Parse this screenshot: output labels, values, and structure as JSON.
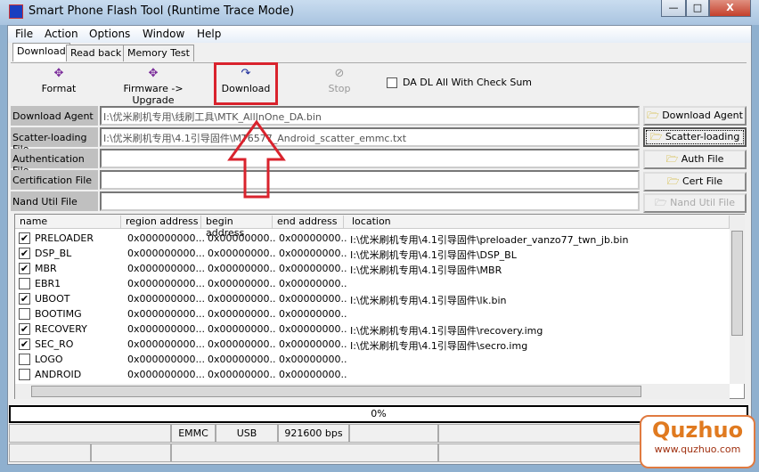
{
  "window": {
    "title": "Smart Phone Flash Tool (Runtime Trace Mode)",
    "minimize": "—",
    "maximize": "□",
    "close": "X"
  },
  "menu": [
    "File",
    "Action",
    "Options",
    "Window",
    "Help"
  ],
  "tabs": [
    "Download",
    "Read back",
    "Memory Test"
  ],
  "toolbar": {
    "format": "Format",
    "firmware_upgrade": "Firmware -> Upgrade",
    "download": "Download",
    "stop": "Stop",
    "checksum_label": "DA DL All With Check Sum",
    "checksum_checked": false
  },
  "fields": [
    {
      "label": "Download Agent",
      "value": "I:\\优米刷机专用\\线刷工具\\MTK_AllInOne_DA.bin",
      "button": "Download Agent"
    },
    {
      "label": "Scatter-loading File",
      "value": "I:\\优米刷机专用\\4.1引导固件\\MT6577_Android_scatter_emmc.txt",
      "button": "Scatter-loading"
    },
    {
      "label": "Authentication File",
      "value": "",
      "button": "Auth File"
    },
    {
      "label": "Certification File",
      "value": "",
      "button": "Cert File"
    },
    {
      "label": "Nand Util File",
      "value": "",
      "button": "Nand Util File"
    }
  ],
  "table": {
    "columns": [
      "name",
      "region address",
      "begin address",
      "end address",
      "location"
    ],
    "rows": [
      {
        "checked": true,
        "name": "PRELOADER",
        "region": "0x000000000...",
        "begin": "0x00000000...",
        "end": "0x00000000...",
        "location": "I:\\优米刷机专用\\4.1引导固件\\preloader_vanzo77_twn_jb.bin"
      },
      {
        "checked": true,
        "name": "DSP_BL",
        "region": "0x000000000...",
        "begin": "0x00000000...",
        "end": "0x00000000...",
        "location": "I:\\优米刷机专用\\4.1引导固件\\DSP_BL"
      },
      {
        "checked": true,
        "name": "MBR",
        "region": "0x000000000...",
        "begin": "0x00000000...",
        "end": "0x00000000...",
        "location": "I:\\优米刷机专用\\4.1引导固件\\MBR"
      },
      {
        "checked": false,
        "name": "EBR1",
        "region": "0x000000000...",
        "begin": "0x00000000...",
        "end": "0x00000000...",
        "location": ""
      },
      {
        "checked": true,
        "name": "UBOOT",
        "region": "0x000000000...",
        "begin": "0x00000000...",
        "end": "0x00000000...",
        "location": "I:\\优米刷机专用\\4.1引导固件\\lk.bin"
      },
      {
        "checked": false,
        "name": "BOOTIMG",
        "region": "0x000000000...",
        "begin": "0x00000000...",
        "end": "0x00000000...",
        "location": ""
      },
      {
        "checked": true,
        "name": "RECOVERY",
        "region": "0x000000000...",
        "begin": "0x00000000...",
        "end": "0x00000000...",
        "location": "I:\\优米刷机专用\\4.1引导固件\\recovery.img"
      },
      {
        "checked": true,
        "name": "SEC_RO",
        "region": "0x000000000...",
        "begin": "0x00000000...",
        "end": "0x00000000...",
        "location": "I:\\优米刷机专用\\4.1引导固件\\secro.img"
      },
      {
        "checked": false,
        "name": "LOGO",
        "region": "0x000000000...",
        "begin": "0x00000000...",
        "end": "0x00000000...",
        "location": ""
      },
      {
        "checked": false,
        "name": "ANDROID",
        "region": "0x000000000...",
        "begin": "0x00000000...",
        "end": "0x00000000...",
        "location": ""
      }
    ]
  },
  "progress": {
    "percent": 0,
    "label": "0%"
  },
  "status": {
    "storage": "EMMC",
    "interface": "USB",
    "baud": "921600 bps"
  },
  "watermark": {
    "brand": "Quzhuo",
    "url": "www.quzhuo.com"
  },
  "colors": {
    "highlight": "#d9232d"
  }
}
